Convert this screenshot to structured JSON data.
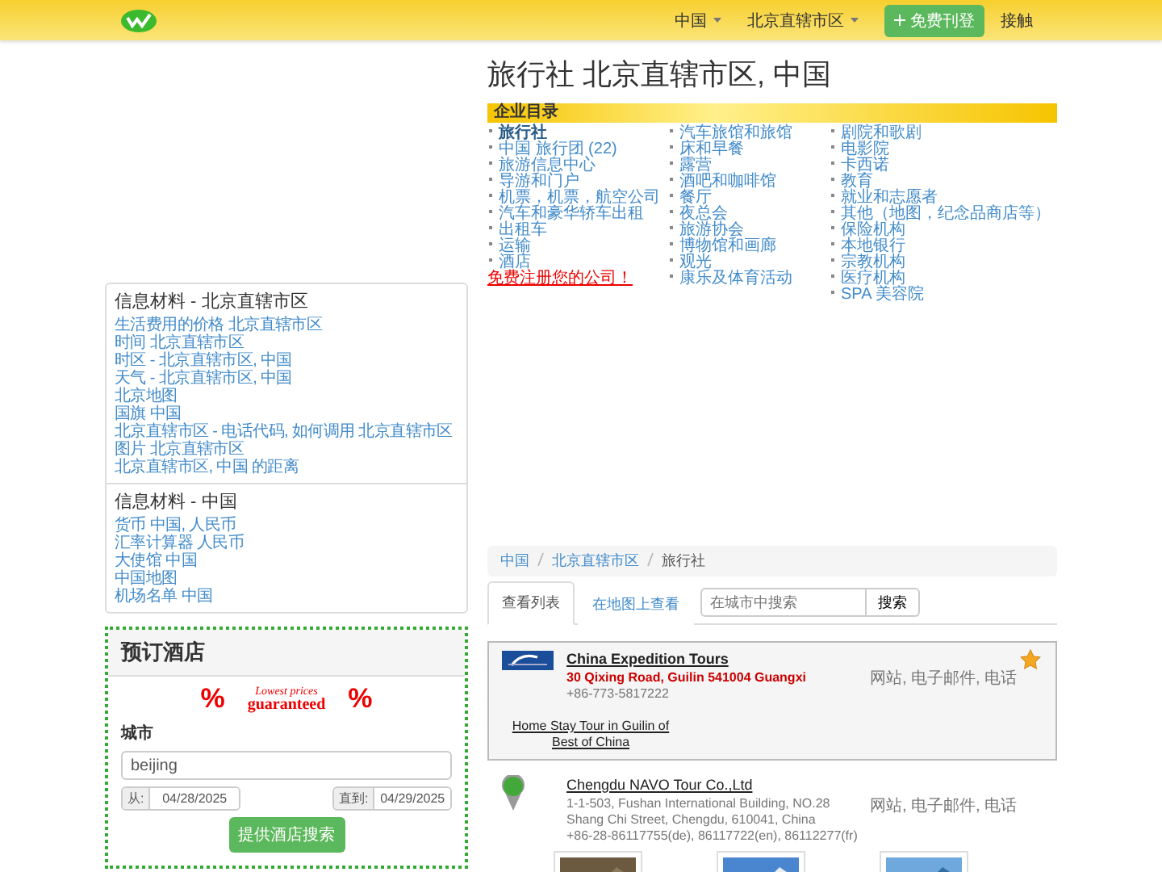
{
  "header": {
    "nav": [
      {
        "label": "中国",
        "dropdown": true
      },
      {
        "label": "北京直辖市区",
        "dropdown": true
      }
    ],
    "register_button": "免费刊登",
    "login_link": "接触"
  },
  "page_title": "旅行社 北京直辖市区, 中国",
  "directory": {
    "heading": "企业目录",
    "columns": [
      [
        {
          "label": "旅行社",
          "selected": true
        },
        {
          "label": "中国 旅行团 (22)",
          "selected": false
        },
        {
          "label": "旅游信息中心",
          "selected": false
        },
        {
          "label": "导游和门户",
          "selected": false
        },
        {
          "label": "机票，机票，航空公司",
          "selected": false
        },
        {
          "label": "汽车和豪华轿车出租",
          "selected": false
        },
        {
          "label": "出租车",
          "selected": false
        },
        {
          "label": "运输",
          "selected": false
        },
        {
          "label": "酒店",
          "selected": false
        }
      ],
      [
        {
          "label": "汽车旅馆和旅馆",
          "selected": false
        },
        {
          "label": "床和早餐",
          "selected": false
        },
        {
          "label": "露营",
          "selected": false
        },
        {
          "label": "酒吧和咖啡馆",
          "selected": false
        },
        {
          "label": "餐厅",
          "selected": false
        },
        {
          "label": "夜总会",
          "selected": false
        },
        {
          "label": "旅游协会",
          "selected": false
        },
        {
          "label": "博物馆和画廊",
          "selected": false
        },
        {
          "label": "观光",
          "selected": false
        },
        {
          "label": "康乐及体育活动",
          "selected": false
        }
      ],
      [
        {
          "label": "剧院和歌剧",
          "selected": false
        },
        {
          "label": "电影院",
          "selected": false
        },
        {
          "label": "卡西诺",
          "selected": false
        },
        {
          "label": "教育",
          "selected": false
        },
        {
          "label": "就业和志愿者",
          "selected": false
        },
        {
          "label": "其他（地图，纪念品商店等）",
          "selected": false
        },
        {
          "label": "保险机构",
          "selected": false
        },
        {
          "label": "本地银行",
          "selected": false
        },
        {
          "label": "宗教机构",
          "selected": false
        },
        {
          "label": "医疗机构",
          "selected": false
        },
        {
          "label": "SPA 美容院",
          "selected": false
        }
      ]
    ],
    "register_link": "免费注册您的公司！"
  },
  "info_sections": [
    {
      "title": "信息材料 - 北京直辖市区",
      "links": [
        "生活费用的价格 北京直辖市区",
        "时间 北京直辖市区",
        "时区 - 北京直辖市区, 中国",
        "天气 - 北京直辖市区, 中国",
        "北京地图",
        "国旗 中国",
        "北京直辖市区 - 电话代码, 如何调用 北京直辖市区",
        "图片 北京直辖市区",
        "北京直辖市区, 中国 的距离"
      ]
    },
    {
      "title": "信息材料 - 中国",
      "links": [
        "货币 中国, 人民币",
        "汇率计算器 人民币",
        "大使馆 中国",
        "中国地图",
        "机场名单 中国"
      ]
    }
  ],
  "hotel": {
    "title": "预订酒店",
    "promo_sign_left": "%",
    "promo_top": "Lowest prices",
    "promo_bottom": "guaranteed",
    "promo_sign_right": "%",
    "city_label": "城市",
    "city_value": "beijing",
    "from_label": "从:",
    "from_value": "04/28/2025",
    "to_label": "直到:",
    "to_value": "04/29/2025",
    "search_button": "提供酒店搜索"
  },
  "breadcrumb": [
    {
      "label": "中国",
      "current": false
    },
    {
      "label": "北京直辖市区",
      "current": false
    },
    {
      "label": "旅行社",
      "current": true
    }
  ],
  "view_tabs": [
    {
      "label": "查看列表",
      "selected": true
    },
    {
      "label": "在地图上查看",
      "selected": false
    }
  ],
  "city_search": {
    "placeholder": "在城市中搜索",
    "button": "搜索"
  },
  "listings": [
    {
      "kind": "featured",
      "name": "China Expedition Tours",
      "address": [
        "30 Qixing Road, Guilin 541004 Guangxi"
      ],
      "phone": "+86-773-5817222",
      "contacts": "网站, 电子邮件, 电话",
      "starred": true,
      "tagline": "Home Stay Tour in Guilin of Best of China"
    },
    {
      "kind": "regular",
      "name": "Chengdu NAVO Tour Co.,Ltd",
      "address": [
        "1-1-503, Fushan International Building, NO.28 Shang Chi Street, Chengdu, 610041, China"
      ],
      "phone": "+86-28-86117755(de), 86117722(en), 86112277(fr)",
      "contacts": "网站, 电子邮件, 电话",
      "starred": false,
      "photos": [
        {
          "kind": "picture"
        },
        {
          "kind": "picture"
        },
        {
          "kind": "picture"
        }
      ]
    }
  ]
}
